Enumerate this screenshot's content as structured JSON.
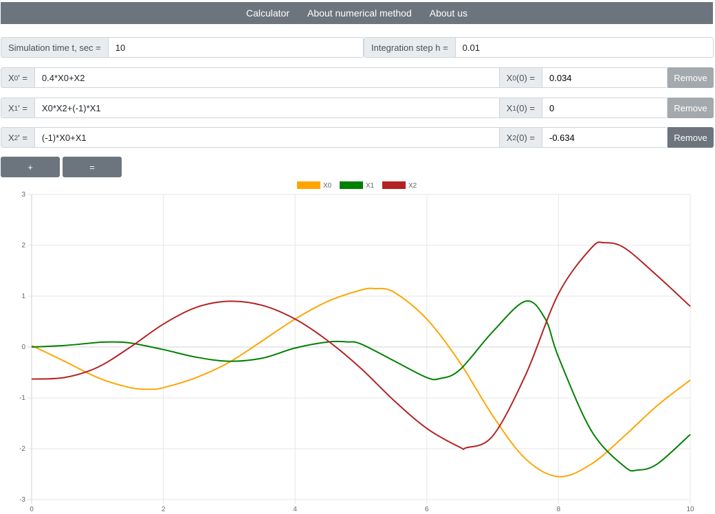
{
  "nav": {
    "items": [
      {
        "label": "Calculator"
      },
      {
        "label": "About numerical method"
      },
      {
        "label": "About us"
      }
    ]
  },
  "settings": {
    "time_label": "Simulation time t, sec =",
    "time_value": "10",
    "step_label": "Integration step h =",
    "step_value": "0.01"
  },
  "equations": [
    {
      "var": "X",
      "sub": "0",
      "expr": "0.4*X0+X2",
      "init": "0.034",
      "remove": "Remove"
    },
    {
      "var": "X",
      "sub": "1",
      "expr": "X0*X2+(-1)*X1",
      "init": "0",
      "remove": "Remove"
    },
    {
      "var": "X",
      "sub": "2",
      "expr": "(-1)*X0+X1",
      "init": "-0.634",
      "remove": "Remove"
    }
  ],
  "eq_suffix": "' =",
  "init_suffix": "(0) =",
  "actions": {
    "add_label": "+",
    "calc_label": "="
  },
  "chart_data": {
    "type": "line",
    "xlim": [
      0,
      10
    ],
    "ylim": [
      -3,
      3
    ],
    "x_ticks": [
      "0",
      "2",
      "4",
      "6",
      "8",
      "10"
    ],
    "y_ticks": [
      "3",
      "2",
      "1",
      "0",
      "-1",
      "-2",
      "-3"
    ],
    "grid": true,
    "legend_position": "top",
    "series": [
      {
        "name": "X0",
        "color": "#ffa500",
        "x": [
          0,
          0.5,
          1,
          1.5,
          1.8,
          2,
          2.5,
          3,
          3.5,
          4,
          4.5,
          5,
          5.2,
          5.5,
          6,
          6.5,
          7,
          7.5,
          8,
          8.5,
          9,
          9.5,
          10
        ],
        "y": [
          0.03,
          -0.28,
          -0.6,
          -0.8,
          -0.83,
          -0.8,
          -0.6,
          -0.3,
          0.12,
          0.55,
          0.9,
          1.12,
          1.15,
          1.08,
          0.55,
          -0.3,
          -1.35,
          -2.2,
          -2.55,
          -2.3,
          -1.75,
          -1.15,
          -0.65
        ]
      },
      {
        "name": "X1",
        "color": "#008000",
        "x": [
          0,
          0.5,
          1,
          1.2,
          1.5,
          2,
          2.5,
          3,
          3.5,
          4,
          4.5,
          4.8,
          5,
          5.5,
          6,
          6.2,
          6.5,
          7,
          7.5,
          7.8,
          8,
          8.5,
          9,
          9.2,
          9.5,
          10
        ],
        "y": [
          0.0,
          0.03,
          0.09,
          0.1,
          0.08,
          -0.05,
          -0.2,
          -0.28,
          -0.22,
          -0.02,
          0.1,
          0.1,
          0.06,
          -0.27,
          -0.6,
          -0.62,
          -0.45,
          0.3,
          0.9,
          0.55,
          -0.2,
          -1.65,
          -2.35,
          -2.42,
          -2.3,
          -1.72
        ]
      },
      {
        "name": "X2",
        "color": "#b22222",
        "x": [
          0,
          0.5,
          1,
          1.5,
          2,
          2.5,
          3,
          3.5,
          4,
          4.5,
          5,
          5.5,
          6,
          6.5,
          6.6,
          7,
          7.5,
          8,
          8.5,
          8.7,
          9,
          9.5,
          10
        ],
        "y": [
          -0.63,
          -0.6,
          -0.4,
          0.0,
          0.45,
          0.78,
          0.9,
          0.82,
          0.55,
          0.12,
          -0.42,
          -1.05,
          -1.6,
          -1.97,
          -1.98,
          -1.75,
          -0.55,
          1.05,
          1.95,
          2.05,
          1.95,
          1.4,
          0.8
        ]
      }
    ]
  }
}
